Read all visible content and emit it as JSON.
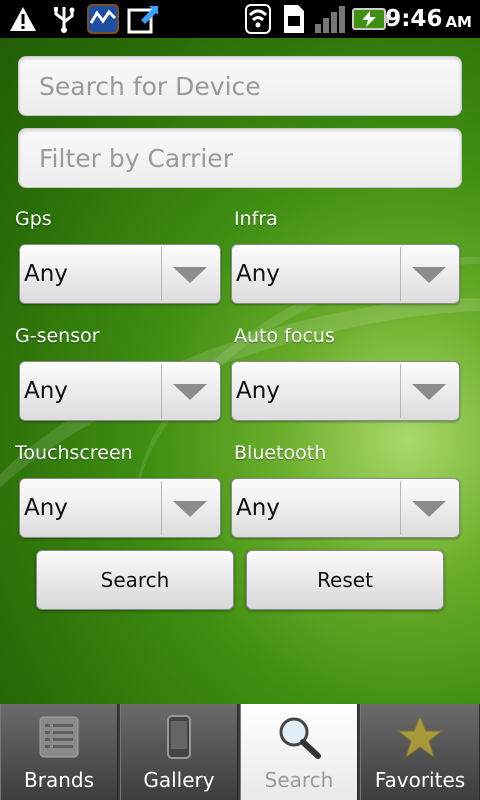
{
  "status_bar": {
    "icons": [
      "warning-icon",
      "usb-icon",
      "activity-icon",
      "download-icon",
      "wifi-icon",
      "sim-icon",
      "signal-icon",
      "battery-icon"
    ],
    "time": "9:46",
    "ampm": "AM"
  },
  "search": {
    "device_placeholder": "Search for Device",
    "carrier_placeholder": "Filter by Carrier"
  },
  "filters": [
    {
      "label": "Gps",
      "value": "Any"
    },
    {
      "label": "Infra",
      "value": "Any"
    },
    {
      "label": "G-sensor",
      "value": "Any"
    },
    {
      "label": "Auto focus",
      "value": "Any"
    },
    {
      "label": "Touchscreen",
      "value": "Any"
    },
    {
      "label": "Bluetooth",
      "value": "Any"
    }
  ],
  "buttons": {
    "search": "Search",
    "reset": "Reset"
  },
  "tabs": [
    {
      "label": "Brands",
      "icon": "list-icon"
    },
    {
      "label": "Gallery",
      "icon": "phone-icon"
    },
    {
      "label": "Search",
      "icon": "magnifier-icon",
      "active": true
    },
    {
      "label": "Favorites",
      "icon": "star-icon"
    }
  ],
  "colors": {
    "background_green": "#3f8f12",
    "active_tab": "#ffffff"
  }
}
